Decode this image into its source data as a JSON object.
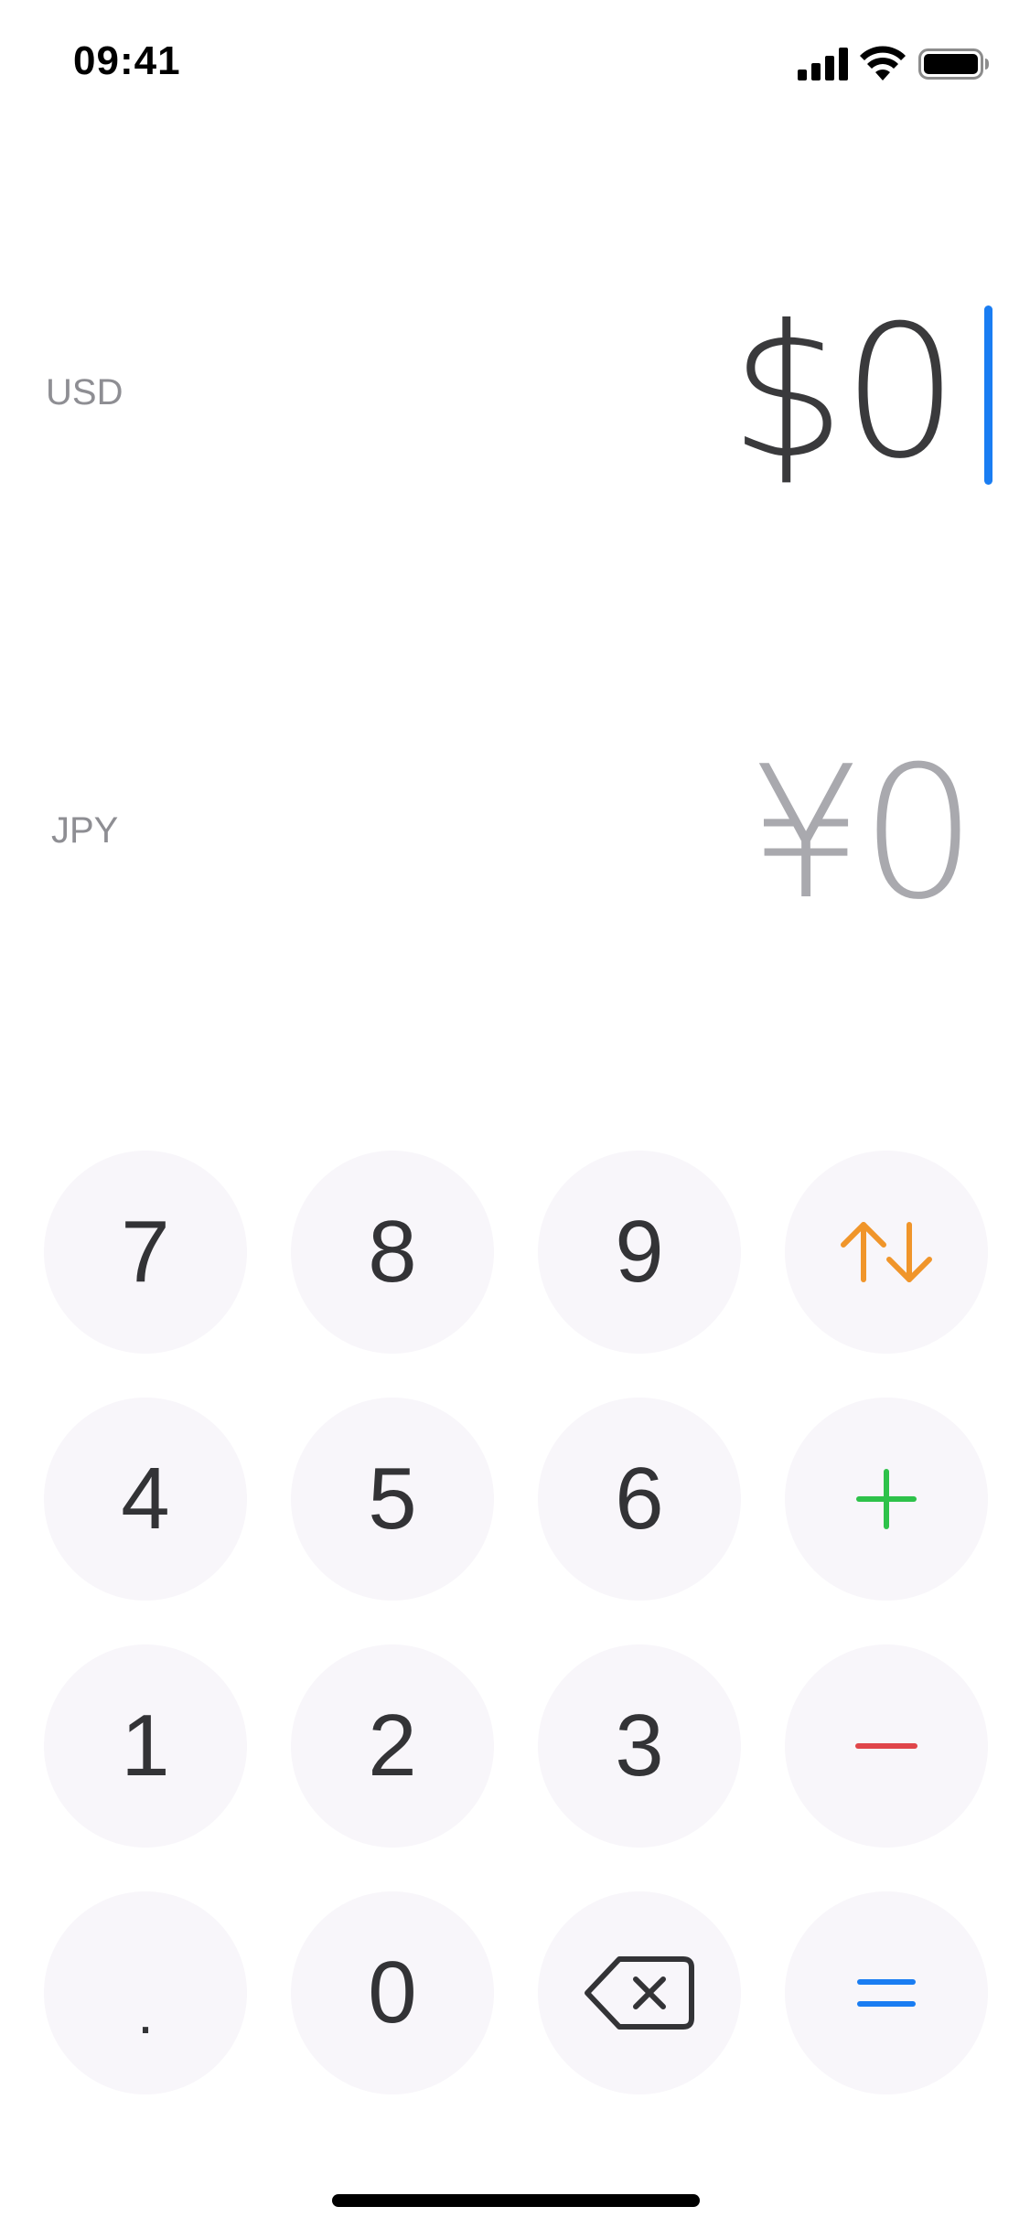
{
  "status_bar": {
    "time": "09:41",
    "icons": [
      "signal-icon",
      "wifi-icon",
      "battery-icon"
    ]
  },
  "converter": {
    "from": {
      "code": "USD",
      "amount": "$0"
    },
    "to": {
      "code": "JPY",
      "amount": "¥0"
    }
  },
  "keypad": {
    "rows": [
      [
        {
          "label": "7"
        },
        {
          "label": "8"
        },
        {
          "label": "9"
        },
        {
          "icon": "swap-arrows-icon"
        }
      ],
      [
        {
          "label": "4"
        },
        {
          "label": "5"
        },
        {
          "label": "6"
        },
        {
          "icon": "plus-icon"
        }
      ],
      [
        {
          "label": "1"
        },
        {
          "label": "2"
        },
        {
          "label": "3"
        },
        {
          "icon": "minus-icon"
        }
      ],
      [
        {
          "label": "."
        },
        {
          "label": "0"
        },
        {
          "icon": "backspace-icon"
        },
        {
          "icon": "equals-icon"
        }
      ]
    ]
  },
  "colors": {
    "caret": "#1a7df2",
    "swap": "#f0952a",
    "plus": "#2ec24a",
    "minus": "#e0464a",
    "equals": "#1a7df2",
    "key_background": "#f8f6fa",
    "secondary_amount": "#a9a9ae"
  }
}
